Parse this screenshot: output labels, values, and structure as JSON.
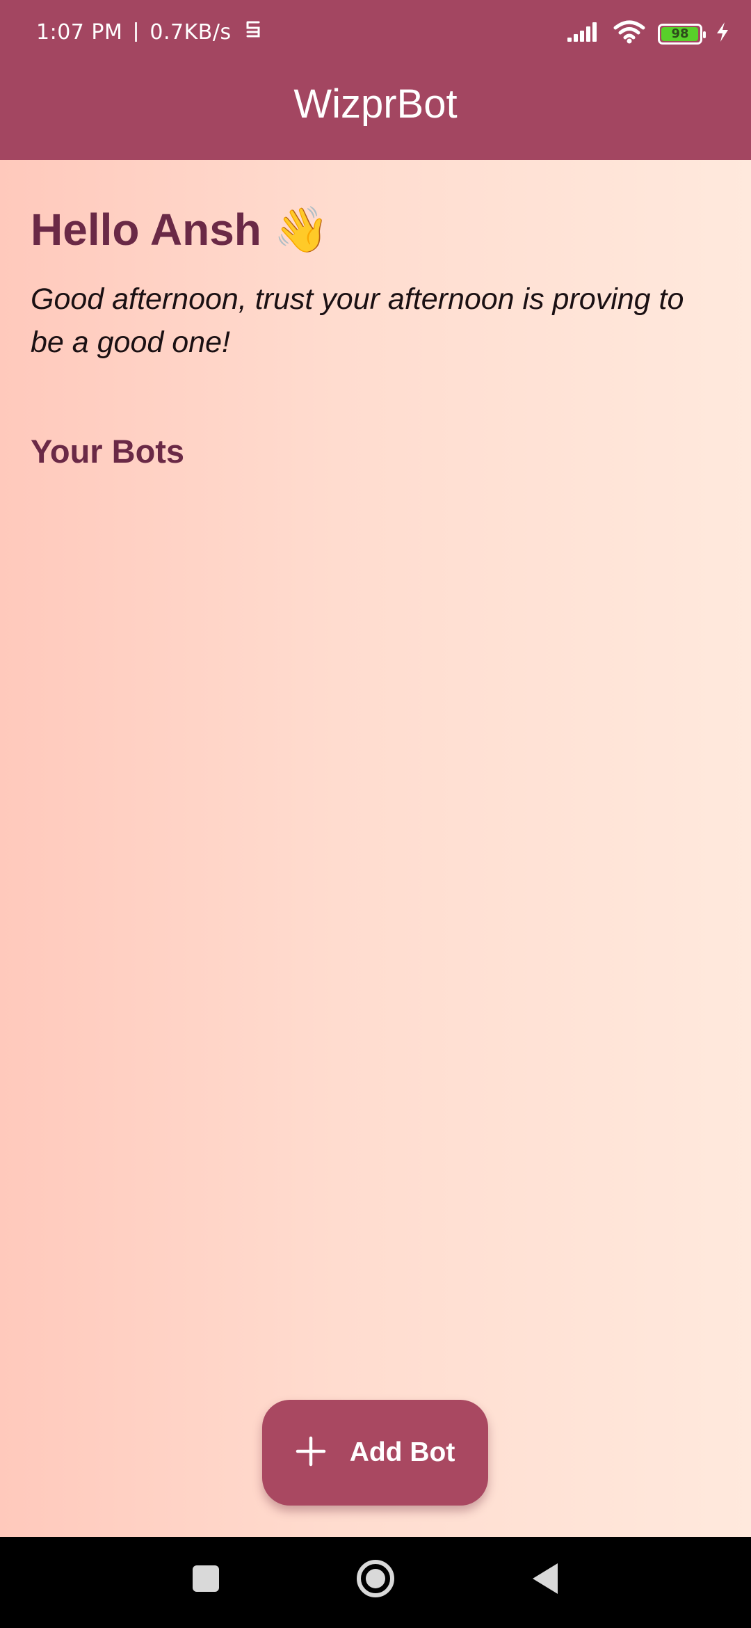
{
  "status_bar": {
    "time": "1:07 PM",
    "network_speed": "0.7KB/s",
    "battery_level": "98",
    "icons": [
      "notification-icon",
      "signal-icon",
      "wifi-icon",
      "battery-icon",
      "charging-icon"
    ]
  },
  "app_bar": {
    "title": "WizprBot"
  },
  "main": {
    "greeting": "Hello Ansh 👋",
    "subtitle": "Good afternoon, trust your afternoon is proving to be a good one!",
    "section_title": "Your Bots",
    "bots": []
  },
  "fab": {
    "label": "Add Bot",
    "icon": "plus-icon"
  },
  "nav_bar": {
    "buttons": [
      "recents-icon",
      "home-icon",
      "back-icon"
    ]
  },
  "colors": {
    "primary": "#a34661",
    "fab": "#a94861",
    "heading": "#6a2946",
    "background_start": "#ffc9bc",
    "background_end": "#ffe9dd",
    "battery_fill": "#58d02a"
  }
}
